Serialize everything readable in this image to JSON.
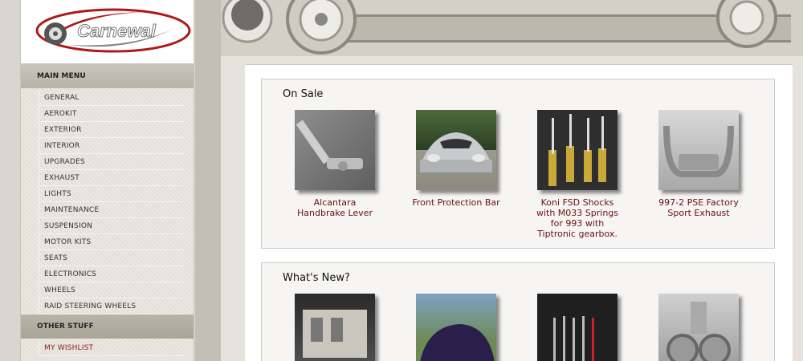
{
  "logo": {
    "text": "Carnewal"
  },
  "main_menu": {
    "title": "MAIN MENU",
    "items": [
      "GENERAL",
      "AEROKIT",
      "EXTERIOR",
      "INTERIOR",
      "UPGRADES",
      "EXHAUST",
      "LIGHTS",
      "MAINTENANCE",
      "SUSPENSION",
      "MOTOR KITS",
      "SEATS",
      "ELECTRONICS",
      "WHEELS",
      "RAID STEERING WHEELS"
    ]
  },
  "other_stuff": {
    "title": "OTHER STUFF",
    "items": [
      "MY WISHLIST"
    ]
  },
  "on_sale": {
    "title": "On Sale",
    "products": [
      {
        "name": "Alcantara Handbrake Lever"
      },
      {
        "name": "Front Protection Bar"
      },
      {
        "name": "Koni FSD Shocks with M033 Springs for 993 with Tiptronic gearbox."
      },
      {
        "name": "997-2 PSE Factory Sport Exhaust"
      }
    ]
  },
  "whats_new": {
    "title": "What's New?",
    "products": [
      {},
      {},
      {},
      {}
    ]
  },
  "colors": {
    "product_link": "#6b1010",
    "logo_red": "#b01818",
    "menu_bg": "#e7e4de"
  }
}
